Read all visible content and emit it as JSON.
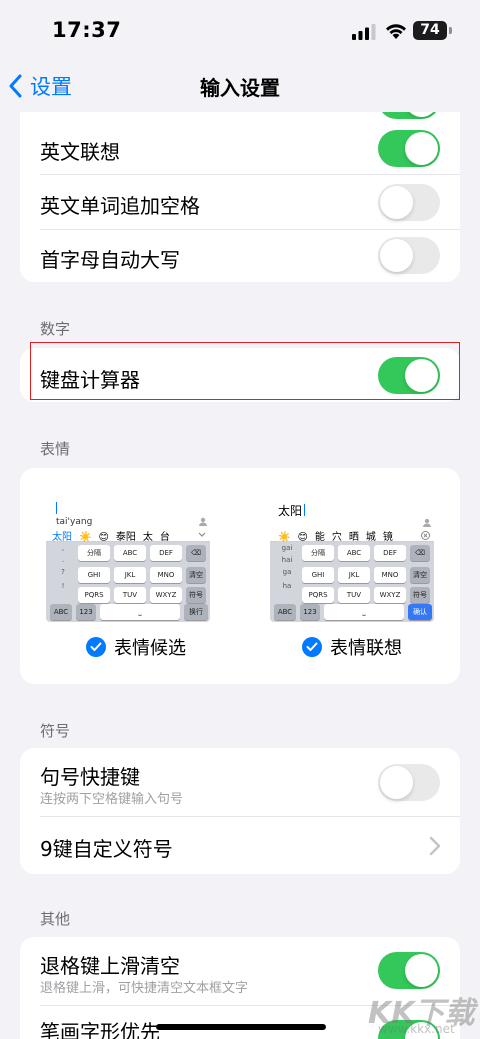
{
  "status": {
    "time": "17:37",
    "battery": "74"
  },
  "nav": {
    "back_label": "设置",
    "title": "输入设置"
  },
  "top_group": {
    "rows": [
      {
        "label": "英文联想",
        "on": true
      },
      {
        "label": "英文单词追加空格",
        "on": false
      },
      {
        "label": "首字母自动大写",
        "on": false
      }
    ]
  },
  "numbers": {
    "header": "数字",
    "row": {
      "label": "键盘计算器",
      "on": true
    }
  },
  "emoji": {
    "header": "表情",
    "left": {
      "pinyin": "tai'yang",
      "candidates": [
        "太阳",
        "☀️",
        "😊",
        "泰阳",
        "太",
        "台"
      ],
      "row1": [
        "分隔",
        "ABC",
        "DEF"
      ],
      "row2": [
        "GHI",
        "JKL",
        "MNO",
        "清空"
      ],
      "row3": [
        "PQRS",
        "TUV",
        "WXYZ",
        "符号"
      ],
      "bottom": [
        "ABC",
        "123",
        "换行"
      ],
      "side": [
        ",",
        ".",
        "?",
        "!"
      ],
      "option_label": "表情候选",
      "checked": true
    },
    "right": {
      "typed": "太阳",
      "candidates": [
        "☀️",
        "😊",
        "能",
        "穴",
        "晒",
        "城",
        "镜"
      ],
      "row1": [
        "分隔",
        "ABC",
        "DEF"
      ],
      "row2": [
        "GHI",
        "JKL",
        "MNO",
        "清空"
      ],
      "row3": [
        "PQRS",
        "TUV",
        "WXYZ",
        "符号"
      ],
      "bottom": [
        "ABC",
        "123",
        "确认"
      ],
      "side": [
        "gai",
        "hai",
        "ga",
        "ha"
      ],
      "option_label": "表情联想",
      "checked": true
    }
  },
  "symbols": {
    "header": "符号",
    "period_shortcut": {
      "label": "句号快捷键",
      "sub": "连按两下空格键输入句号",
      "on": false
    },
    "custom_nine_key": {
      "label": "9键自定义符号"
    }
  },
  "other": {
    "header": "其他",
    "backspace_clear": {
      "label": "退格键上滑清空",
      "sub": "退格键上滑，可快捷清空文本框文字",
      "on": true
    },
    "stroke_first": {
      "label": "笔画字形优先",
      "on": true
    }
  },
  "watermark": {
    "text": "KK下载",
    "url": "www.kkx.net"
  },
  "colors": {
    "accent": "#007aff",
    "toggle_on": "#34c759",
    "highlight": "#e02020"
  }
}
